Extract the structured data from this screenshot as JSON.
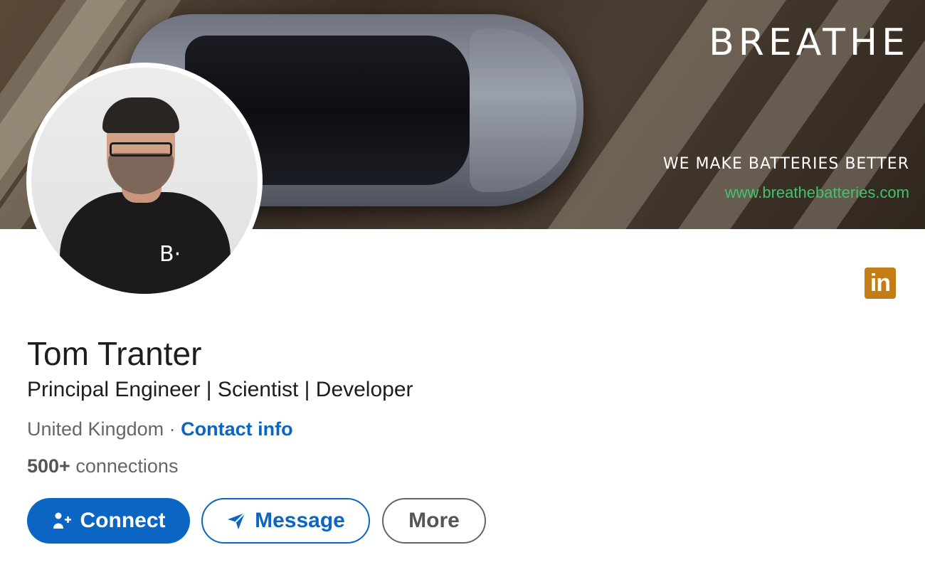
{
  "banner": {
    "brand": "BREATHE",
    "tagline": "WE MAKE BATTERIES BETTER",
    "url": "www.breathebatteries.com"
  },
  "avatar": {
    "shirt_logo": "B·"
  },
  "badge": {
    "label": "in",
    "color": "#c37d16"
  },
  "profile": {
    "name": "Tom Tranter",
    "headline": "Principal Engineer | Scientist | Developer",
    "location": "United Kingdom",
    "separator": "·",
    "contact_info": "Contact info",
    "connections_count": "500+",
    "connections_label": "connections"
  },
  "actions": {
    "connect": "Connect",
    "message": "Message",
    "more": "More"
  },
  "colors": {
    "primary": "#0a66c2",
    "link": "#0a66c2",
    "text": "#1d1d1d",
    "muted": "#666666",
    "brand_green": "#3fc46a"
  },
  "icons": {
    "connect": "add-person-icon",
    "message": "paper-plane-icon",
    "badge": "linkedin-icon"
  }
}
